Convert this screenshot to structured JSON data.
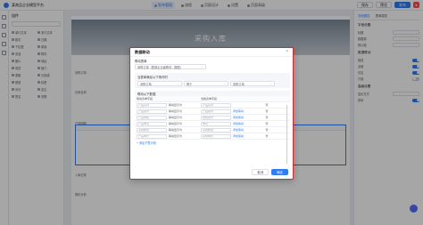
{
  "app": {
    "title": "某商品企业模型平台",
    "tabs": [
      "发布管理",
      "流程",
      "页面设计",
      "设置",
      "页面高级"
    ],
    "header_buttons": [
      "保存",
      "预览",
      "发布"
    ]
  },
  "component_panel": {
    "title": "组件",
    "items": [
      "单行文本",
      "多行文本",
      "数字",
      "日期",
      "下拉框",
      "单选",
      "多选",
      "附件",
      "图片",
      "地址",
      "成员",
      "部门",
      "表格",
      "分割线",
      "按钮",
      "标签",
      "评分",
      "定位",
      "签名",
      "关联"
    ]
  },
  "canvas": {
    "banner_title": "采购入库",
    "field_labels": [
      "采购订单",
      "仓库名称",
      "产品明细"
    ],
    "table_label": "产品明细",
    "lower_label": "入库记录",
    "lower_label2": "物料分析"
  },
  "properties": {
    "tabs": [
      "字段属性",
      "表单属性"
    ],
    "rows": [
      "标题",
      "数据源",
      "默认值",
      "描述",
      "必填",
      "可见",
      "只读",
      "显示方式",
      "排序"
    ],
    "sections": [
      "字段设置",
      "数据联动",
      "高级设置"
    ]
  },
  "modal": {
    "title": "数据联动",
    "close_icon": "close-icon",
    "source_label": "联动表单",
    "source_value": "采购订单（配置企业级联动 - 数据）",
    "condition_title": "当表单满足以下条件时",
    "filter_field": "采购订单",
    "filter_op": "等于",
    "filter_value": "采购订单",
    "table_title": "联动以下数据",
    "columns": [
      "联动表单字段",
      "",
      "当前表单字段",
      ""
    ],
    "rows": [
      {
        "src": "产品名称",
        "op": "联动显示为",
        "dst": "产品名称",
        "link": ""
      },
      {
        "src": "产品编号",
        "op": "联动显示为",
        "dst": "产品编号",
        "link": "添加联动"
      },
      {
        "src": "产品规格",
        "op": "联动显示为",
        "dst": "规格型号",
        "link": "添加联动"
      },
      {
        "src": "产品单位",
        "op": "联动显示为",
        "dst": "单位",
        "link": "添加联动"
      },
      {
        "src": "采购数量",
        "op": "联动显示为",
        "dst": "采购数量",
        "link": "添加联动"
      },
      {
        "src": "产品单价",
        "op": "联动显示为",
        "dst": "采购单价",
        "link": "添加联动"
      }
    ],
    "add_link": "+ 添加子表字段",
    "cancel_label": "取消",
    "ok_label": "确定"
  },
  "colors": {
    "accent": "#2e7cf6",
    "modal_border": "#e0262a",
    "overlay": "rgba(0,0,0,0.35)"
  }
}
